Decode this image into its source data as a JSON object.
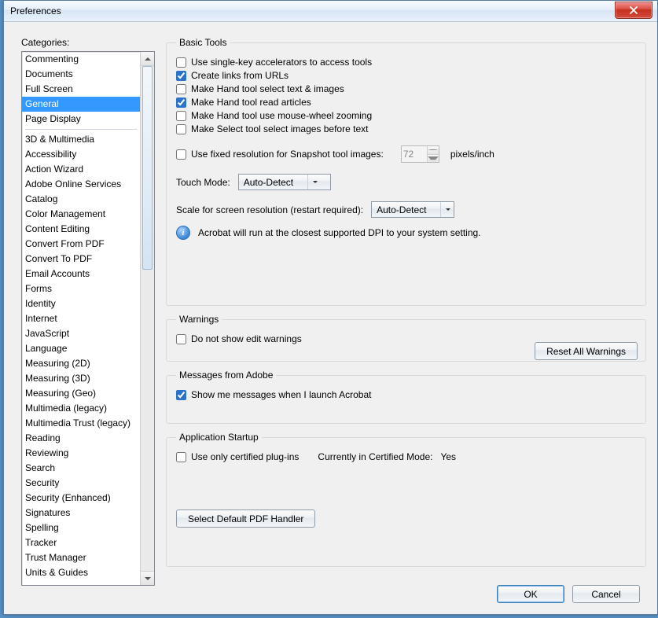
{
  "window": {
    "title": "Preferences"
  },
  "sidebar": {
    "label": "Categories:",
    "top_items": [
      "Commenting",
      "Documents",
      "Full Screen",
      "General",
      "Page Display"
    ],
    "selected_index": 3,
    "bottom_items": [
      "3D & Multimedia",
      "Accessibility",
      "Action Wizard",
      "Adobe Online Services",
      "Catalog",
      "Color Management",
      "Content Editing",
      "Convert From PDF",
      "Convert To PDF",
      "Email Accounts",
      "Forms",
      "Identity",
      "Internet",
      "JavaScript",
      "Language",
      "Measuring (2D)",
      "Measuring (3D)",
      "Measuring (Geo)",
      "Multimedia (legacy)",
      "Multimedia Trust (legacy)",
      "Reading",
      "Reviewing",
      "Search",
      "Security",
      "Security (Enhanced)",
      "Signatures",
      "Spelling",
      "Tracker",
      "Trust Manager",
      "Units & Guides"
    ]
  },
  "basic_tools": {
    "legend": "Basic Tools",
    "options": [
      {
        "label": "Use single-key accelerators to access tools",
        "checked": false
      },
      {
        "label": "Create links from URLs",
        "checked": true
      },
      {
        "label": "Make Hand tool select text & images",
        "checked": false
      },
      {
        "label": "Make Hand tool read articles",
        "checked": true
      },
      {
        "label": "Make Hand tool use mouse-wheel zooming",
        "checked": false
      },
      {
        "label": "Make Select tool select images before text",
        "checked": false
      }
    ],
    "snapshot": {
      "label": "Use fixed resolution for Snapshot tool images:",
      "checked": false,
      "value": "72",
      "unit": "pixels/inch"
    },
    "touch_mode": {
      "label": "Touch Mode:",
      "value": "Auto-Detect"
    },
    "scale": {
      "label": "Scale for screen resolution (restart required):",
      "value": "Auto-Detect"
    },
    "info_text": "Acrobat will run at the closest supported DPI to your system setting."
  },
  "warnings": {
    "legend": "Warnings",
    "option": {
      "label": "Do not show edit warnings",
      "checked": false
    },
    "reset_button": "Reset All Warnings"
  },
  "messages": {
    "legend": "Messages from Adobe",
    "option": {
      "label": "Show me messages when I launch Acrobat",
      "checked": true
    }
  },
  "startup": {
    "legend": "Application Startup",
    "option": {
      "label": "Use only certified plug-ins",
      "checked": false
    },
    "cert_mode_label": "Currently in Certified Mode:",
    "cert_mode_value": "Yes",
    "button": "Select Default PDF Handler"
  },
  "footer": {
    "ok": "OK",
    "cancel": "Cancel"
  }
}
